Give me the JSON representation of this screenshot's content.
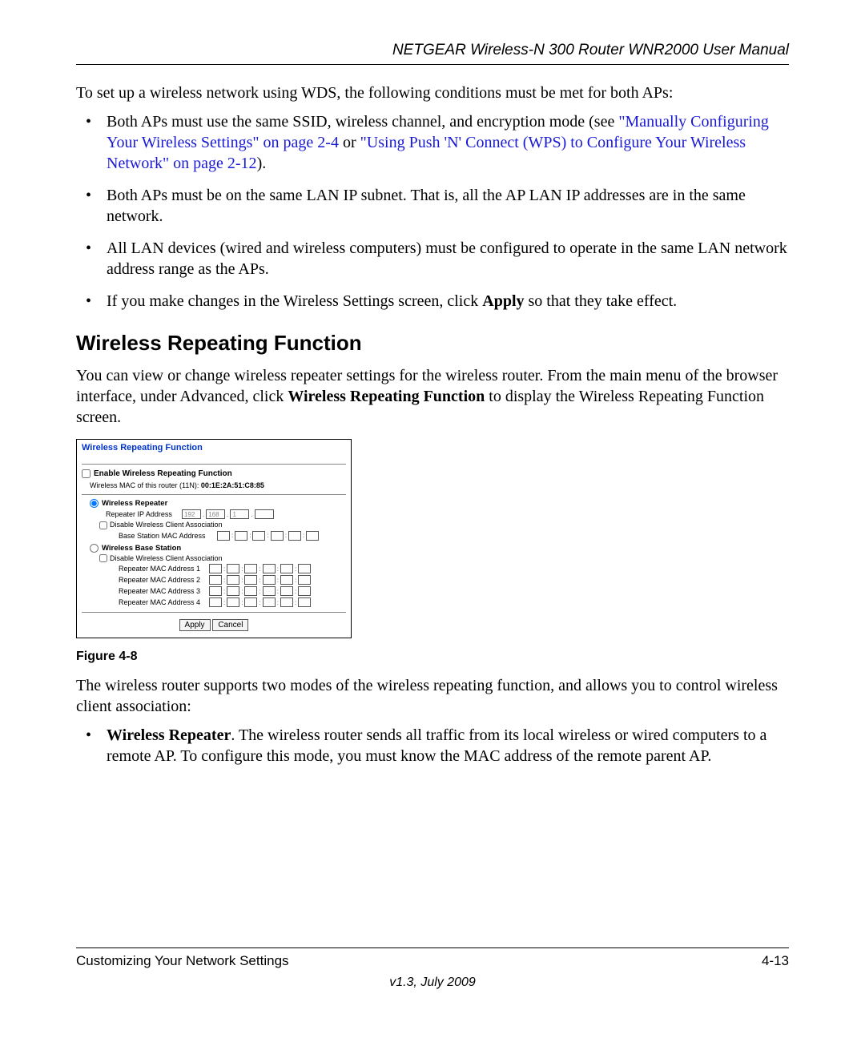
{
  "header": {
    "manual_title": "NETGEAR Wireless-N 300 Router WNR2000 User Manual"
  },
  "intro_para": "To set up a wireless network using WDS, the following conditions must be met for both APs:",
  "bullets": {
    "b1_pre": "Both APs must use the same SSID, wireless channel, and encryption mode (see ",
    "b1_link1": "\"Manually Configuring Your Wireless Settings\" on page 2-4",
    "b1_mid": " or ",
    "b1_link2": "\"Using Push 'N' Connect (WPS) to Configure Your Wireless Network\" on page 2-12",
    "b1_post": ").",
    "b2": "Both APs must be on the same LAN IP subnet. That is, all the AP LAN IP addresses are in the same network.",
    "b3": "All LAN devices (wired and wireless computers) must be configured to operate in the same LAN network address range as the APs.",
    "b4_pre": "If you make changes in the Wireless Settings screen, click ",
    "b4_strong": "Apply",
    "b4_post": " so that they take effect."
  },
  "section_heading": "Wireless Repeating Function",
  "section_para_pre": "You can view or change wireless repeater settings for the wireless router. From the main menu of the browser interface, under Advanced, click ",
  "section_para_strong": "Wireless Repeating Function",
  "section_para_post": " to display the Wireless Repeating Function screen.",
  "panel": {
    "title": "Wireless Repeating Function",
    "enable_label": "Enable Wireless Repeating Function",
    "mac_line_pre": "Wireless MAC of this router (11N): ",
    "mac_line_val": "00:1E:2A:51:C8:85",
    "repeater_radio": "Wireless Repeater",
    "repeater_ip_label": "Repeater IP Address",
    "ip1": "192",
    "ip2": "168",
    "ip3": "1",
    "ip4": "",
    "disable_assoc": "Disable Wireless Client Association",
    "base_mac_label": "Base Station MAC Address",
    "base_radio": "Wireless Base Station",
    "rep_mac1": "Repeater MAC Address 1",
    "rep_mac2": "Repeater MAC Address 2",
    "rep_mac3": "Repeater MAC Address 3",
    "rep_mac4": "Repeater MAC Address 4",
    "apply": "Apply",
    "cancel": "Cancel"
  },
  "figure_caption": "Figure 4-8",
  "after_para": "The wireless router supports two modes of the wireless repeating function, and allows you to control wireless client association:",
  "mode_bullet": {
    "strong": "Wireless Repeater",
    "text": ". The wireless router sends all traffic from its local wireless or wired computers to a remote AP. To configure this mode, you must know the MAC address of the remote parent AP."
  },
  "footer": {
    "section": "Customizing Your Network Settings",
    "page_num": "4-13",
    "version": "v1.3, July 2009"
  }
}
